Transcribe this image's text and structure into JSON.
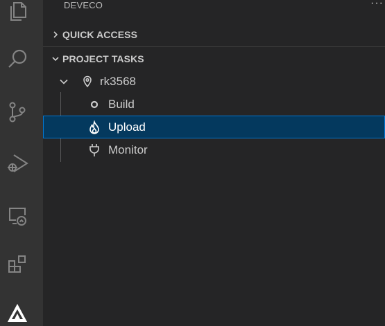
{
  "sidebar": {
    "title": "DEVECO",
    "more": "···",
    "sections": {
      "quick_access": {
        "label": "QUICK ACCESS",
        "expanded": false
      },
      "project_tasks": {
        "label": "PROJECT TASKS",
        "expanded": true
      }
    },
    "tree": {
      "project": {
        "label": "rk3568",
        "icon": "location-pin-icon"
      },
      "tasks": [
        {
          "label": "Build",
          "icon": "circle-icon",
          "selected": false
        },
        {
          "label": "Upload",
          "icon": "flame-icon",
          "selected": true
        },
        {
          "label": "Monitor",
          "icon": "plug-icon",
          "selected": false
        }
      ]
    }
  },
  "activity_bar": {
    "items": [
      "explorer-icon",
      "search-icon",
      "source-control-icon",
      "run-debug-icon",
      "remote-explorer-icon",
      "extensions-icon",
      "deveco-icon"
    ]
  },
  "colors": {
    "selection_bg": "#04395e",
    "selection_border": "#0078d4",
    "sidebar_bg": "#252526",
    "activity_bg": "#333333",
    "icon_color": "#858585"
  }
}
